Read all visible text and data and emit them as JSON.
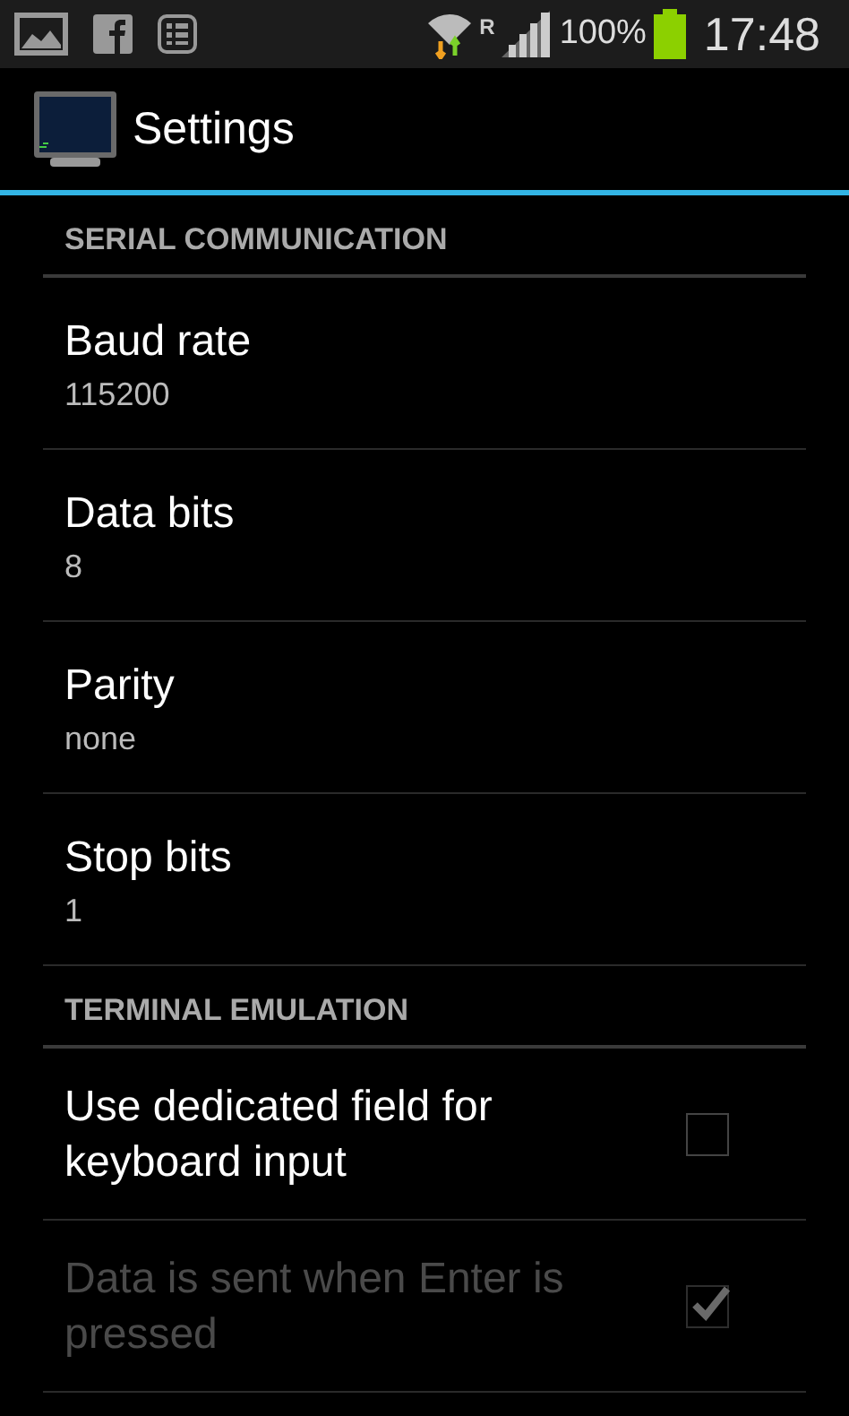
{
  "status_bar": {
    "network_type": "R",
    "battery": "100%",
    "time": "17:48"
  },
  "action_bar": {
    "title": "Settings"
  },
  "sections": [
    {
      "title": "SERIAL COMMUNICATION",
      "items": [
        {
          "kind": "value",
          "title": "Baud rate",
          "summary": "115200"
        },
        {
          "kind": "value",
          "title": "Data bits",
          "summary": "8"
        },
        {
          "kind": "value",
          "title": "Parity",
          "summary": "none"
        },
        {
          "kind": "value",
          "title": "Stop bits",
          "summary": "1"
        }
      ]
    },
    {
      "title": "TERMINAL EMULATION",
      "items": [
        {
          "kind": "checkbox",
          "title": "Use dedicated field for keyboard input",
          "checked": false,
          "disabled": false
        },
        {
          "kind": "checkbox",
          "title": "Data is sent when Enter is pressed",
          "checked": true,
          "disabled": true
        }
      ]
    }
  ]
}
